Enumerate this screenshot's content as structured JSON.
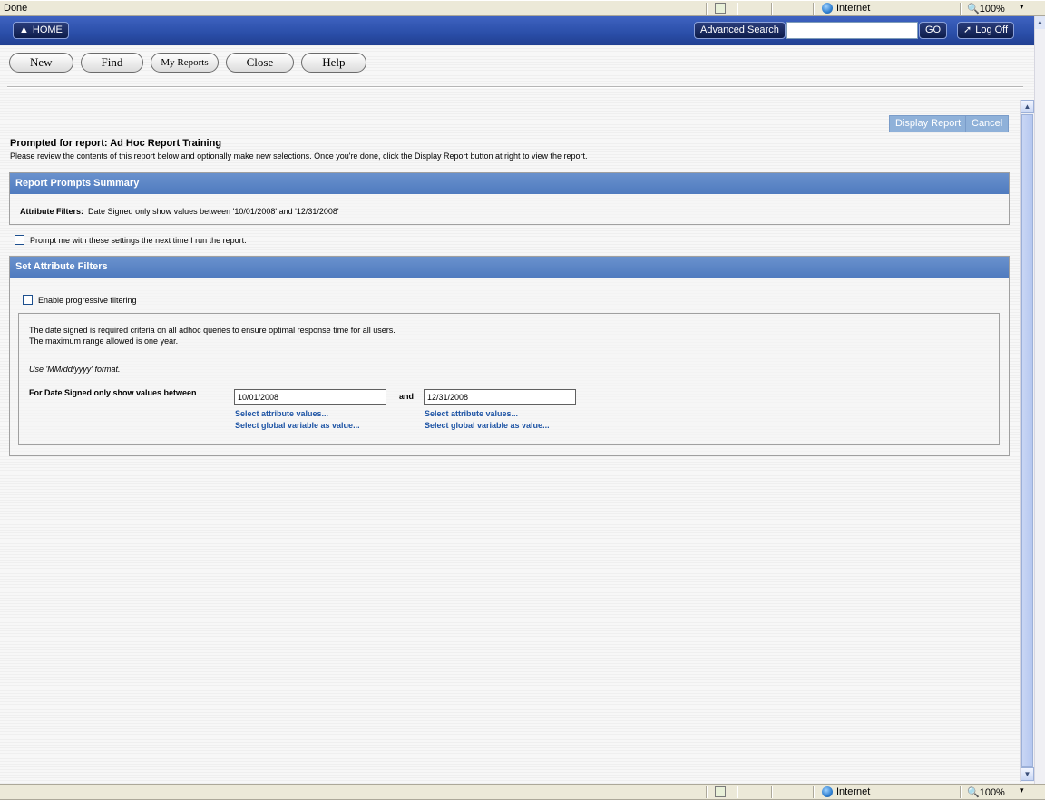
{
  "status_bar": {
    "text": "Done",
    "zone": "Internet",
    "zoom": "100%",
    "dropdown": "▾"
  },
  "header": {
    "home_label": "HOME",
    "advanced_search_label": "Advanced Search",
    "search_value": "",
    "go_label": "GO",
    "logoff_label": "Log Off"
  },
  "toolbar": {
    "new_label": "New",
    "find_label": "Find",
    "my_reports_label": "My Reports",
    "close_label": "Close",
    "help_label": "Help"
  },
  "actions": {
    "display_report": "Display Report",
    "cancel": "Cancel"
  },
  "report": {
    "title": "Prompted for report: Ad Hoc Report Training",
    "description": "Please review the contents of this report below and optionally make new selections. Once you're done, click the Display Report button at right to view the report."
  },
  "summary": {
    "header": "Report Prompts Summary",
    "label": "Attribute Filters:",
    "text": "Date Signed only show values between '10/01/2008' and '12/31/2008'"
  },
  "prompt_checkbox": {
    "label": "Prompt me with these settings the next time I run the report.",
    "checked": false
  },
  "filters": {
    "header": "Set Attribute Filters",
    "progressive_label": "Enable progressive filtering",
    "progressive_checked": false,
    "info_line1": "The date signed is required criteria on all adhoc queries to ensure optimal response time for all users.",
    "info_line2": "The maximum range allowed is one year.",
    "format_hint": "Use 'MM/dd/yyyy' format.",
    "date_label": "For Date Signed only show values between",
    "from_value": "10/01/2008",
    "and_label": "and",
    "to_value": "12/31/2008",
    "select_attr_link": "Select attribute values...",
    "select_global_link": "Select global variable as value..."
  },
  "colors": {
    "header_blue": "#2a4ea8",
    "panel_header": "#5a85c6",
    "link": "#1f55a5",
    "action_button": "#8fb1d9"
  }
}
